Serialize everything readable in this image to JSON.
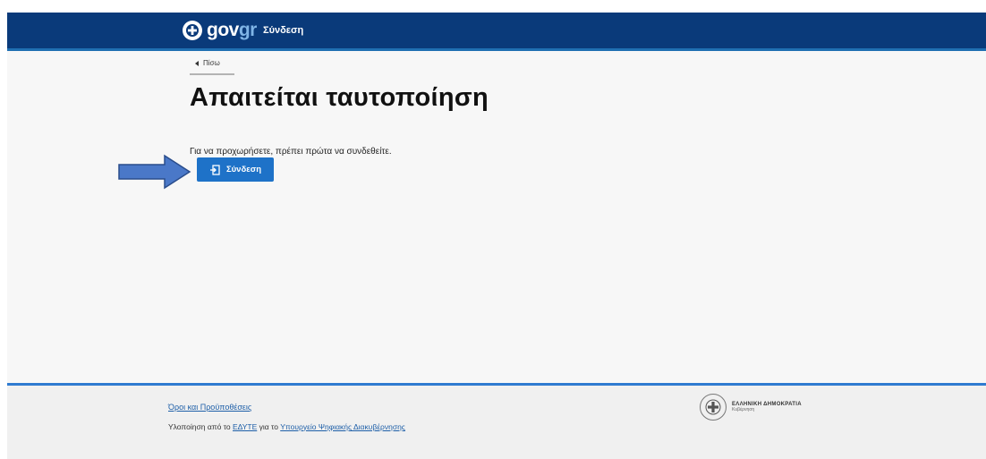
{
  "header": {
    "logo_gov": "gov",
    "logo_gr": "gr",
    "login_link": "Σύνδεση"
  },
  "main": {
    "back_label": "Πίσω",
    "title": "Απαιτείται ταυτοποίηση",
    "intro": "Για να προχωρήσετε, πρέπει πρώτα να συνδεθείτε.",
    "login_button": "Σύνδεση"
  },
  "footer": {
    "terms_link": "Όροι και Προϋποθέσεις",
    "implementation_prefix": "Υλοποίηση από το ",
    "edyte_link": "ΕΔΥΤΕ",
    "middle_text": " για το ",
    "ministry_link": "Υπουργείο Ψηφιακής Διακυβέρνησης",
    "gov_title": "ΕΛΛΗΝΙΚΗ ΔΗΜΟΚΡΑΤΙΑ",
    "gov_sub": "Κυβέρνηση"
  },
  "icons": {
    "logo": "greek-emblem-icon",
    "back": "triangle-left-icon",
    "login": "login-icon",
    "annotation": "arrow-right-icon",
    "footer_emblem": "greek-emblem-icon"
  },
  "colors": {
    "header": "#0a3a7a",
    "accent": "#1e72c8",
    "footer_border": "#2f7bd0",
    "arrow": "#4a78c8"
  }
}
